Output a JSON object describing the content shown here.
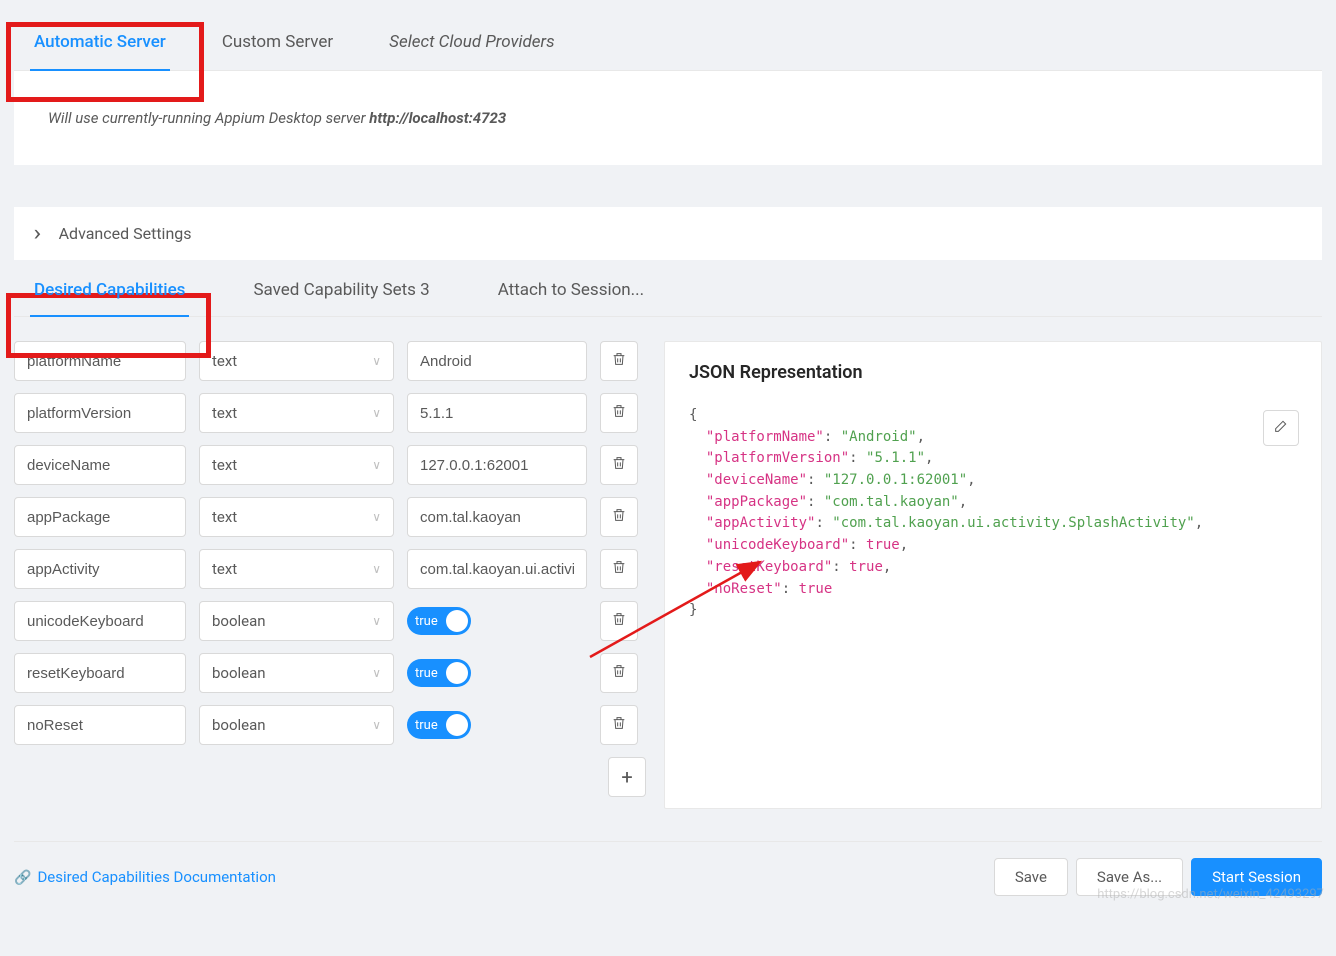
{
  "serverTabs": {
    "automatic": "Automatic Server",
    "custom": "Custom Server",
    "cloud": "Select Cloud Providers"
  },
  "info": {
    "prefix": "Will use currently-running Appium Desktop server ",
    "host": "http://localhost:4723"
  },
  "advanced": {
    "label": "Advanced Settings"
  },
  "capTabs": {
    "desired": "Desired Capabilities",
    "saved": "Saved Capability Sets 3",
    "attach": "Attach to Session..."
  },
  "typeOptions": {
    "text": "text",
    "boolean": "boolean"
  },
  "toggle": {
    "true": "true"
  },
  "rows": [
    {
      "name": "platformName",
      "type": "text",
      "value": "Android"
    },
    {
      "name": "platformVersion",
      "type": "text",
      "value": "5.1.1"
    },
    {
      "name": "deviceName",
      "type": "text",
      "value": "127.0.0.1:62001"
    },
    {
      "name": "appPackage",
      "type": "text",
      "value": "com.tal.kaoyan"
    },
    {
      "name": "appActivity",
      "type": "text",
      "value": "com.tal.kaoyan.ui.activity.SplashActivity",
      "display": "com.tal.kaoyan.ui.activit"
    },
    {
      "name": "unicodeKeyboard",
      "type": "boolean",
      "value": true
    },
    {
      "name": "resetKeyboard",
      "type": "boolean",
      "value": true
    },
    {
      "name": "noReset",
      "type": "boolean",
      "value": true
    }
  ],
  "json": {
    "title": "JSON Representation",
    "body": "{\n  \"platformName\": \"Android\",\n  \"platformVersion\": \"5.1.1\",\n  \"deviceName\": \"127.0.0.1:62001\",\n  \"appPackage\": \"com.tal.kaoyan\",\n  \"appActivity\": \"com.tal.kaoyan.ui.activity.SplashActivity\",\n  \"unicodeKeyboard\": true,\n  \"resetKeyboard\": true,\n  \"noReset\": true\n}"
  },
  "footer": {
    "docLink": "Desired Capabilities Documentation",
    "save": "Save",
    "saveAs": "Save As...",
    "start": "Start Session"
  },
  "watermark": "https://blog.csdn.net/weixin_42493297",
  "colors": {
    "accent": "#1890ff",
    "highlight": "#e31a1a"
  }
}
